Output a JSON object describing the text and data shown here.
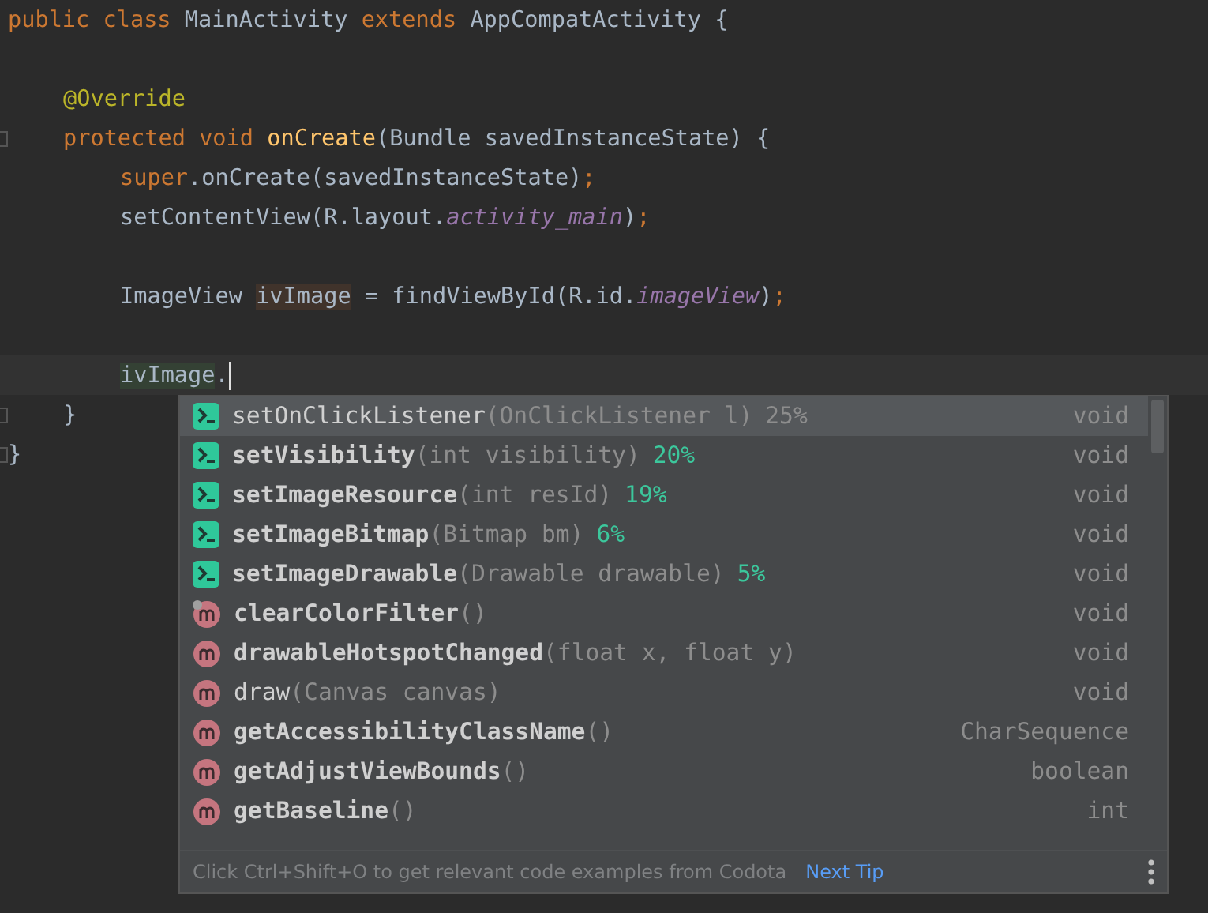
{
  "editor": {
    "lines": [
      {
        "kind": "top",
        "current": false,
        "fold": false,
        "tokens": [
          {
            "text": "public class ",
            "kind": "keyword"
          },
          {
            "text": "MainActivity ",
            "kind": "plain"
          },
          {
            "text": "extends ",
            "kind": "keyword"
          },
          {
            "text": "AppCompatActivity {",
            "kind": "plain"
          }
        ]
      },
      {
        "kind": "top",
        "current": false,
        "fold": false
      },
      {
        "kind": "member",
        "current": false,
        "fold": false,
        "tokens": [
          {
            "text": "@Override",
            "kind": "annotation"
          }
        ]
      },
      {
        "kind": "member",
        "current": false,
        "fold": true,
        "tokens": [
          {
            "text": "protected void ",
            "kind": "keyword"
          },
          {
            "text": "onCreate",
            "kind": "method"
          },
          {
            "text": "(Bundle savedInstanceState) {",
            "kind": "plain"
          }
        ]
      },
      {
        "kind": "body",
        "current": false,
        "fold": false,
        "tokens": [
          {
            "text": "super",
            "kind": "keyword"
          },
          {
            "text": ".onCreate(savedInstanceState)",
            "kind": "plain"
          },
          {
            "text": ";",
            "kind": "keyword"
          }
        ]
      },
      {
        "kind": "body",
        "current": false,
        "fold": false,
        "tokens": [
          {
            "text": "setContentView(R.layout.",
            "kind": "plain"
          },
          {
            "text": "activity_main",
            "kind": "field"
          },
          {
            "text": ")",
            "kind": "plain"
          },
          {
            "text": ";",
            "kind": "keyword"
          }
        ]
      },
      {
        "kind": "body",
        "current": false,
        "fold": false
      },
      {
        "kind": "body",
        "current": false,
        "fold": false,
        "tokens": [
          {
            "text": "ImageView ",
            "kind": "plain"
          },
          {
            "text": "ivImage",
            "kind": "write_usage"
          },
          {
            "text": " = findViewById(R.id.",
            "kind": "plain"
          },
          {
            "text": "imageView",
            "kind": "field"
          },
          {
            "text": ")",
            "kind": "plain"
          },
          {
            "text": ";",
            "kind": "keyword"
          }
        ]
      },
      {
        "kind": "body",
        "current": false,
        "fold": false
      },
      {
        "kind": "body",
        "current": true,
        "fold": false,
        "tokens": [
          {
            "text": "ivImage",
            "kind": "read_usage"
          },
          {
            "text": ".",
            "kind": "plain"
          }
        ]
      },
      {
        "kind": "member",
        "current": false,
        "fold": true,
        "tokens": [
          {
            "text": "}",
            "kind": "plain"
          }
        ]
      },
      {
        "kind": "top",
        "current": false,
        "fold": true,
        "tokens": [
          {
            "text": "}",
            "kind": "plain"
          }
        ]
      }
    ]
  },
  "completion": {
    "items": [
      {
        "kind": "lambda",
        "name": "setOnClickListener",
        "bold": false,
        "params": "(OnClickListener l)",
        "percent": "25%",
        "type": "void",
        "selected": true
      },
      {
        "kind": "lambda",
        "name": "setVisibility",
        "bold": true,
        "params": "(int visibility)",
        "percent": "20%",
        "type": "void",
        "selected": false
      },
      {
        "kind": "lambda",
        "name": "setImageResource",
        "bold": true,
        "params": "(int resId)",
        "percent": "19%",
        "type": "void",
        "selected": false
      },
      {
        "kind": "lambda",
        "name": "setImageBitmap",
        "bold": true,
        "params": "(Bitmap bm)",
        "percent": "6%",
        "type": "void",
        "selected": false
      },
      {
        "kind": "lambda",
        "name": "setImageDrawable",
        "bold": true,
        "params": "(Drawable drawable)",
        "percent": "5%",
        "type": "void",
        "selected": false
      },
      {
        "kind": "marked",
        "name": "clearColorFilter",
        "bold": true,
        "params": "()",
        "type": "void",
        "selected": false
      },
      {
        "kind": "method",
        "name": "drawableHotspotChanged",
        "bold": true,
        "params": "(float x, float y)",
        "type": "void",
        "selected": false
      },
      {
        "kind": "method",
        "name": "draw",
        "bold": false,
        "params": "(Canvas canvas)",
        "type": "void",
        "selected": false
      },
      {
        "kind": "method",
        "name": "getAccessibilityClassName",
        "bold": true,
        "params": "()",
        "type": "CharSequence",
        "selected": false
      },
      {
        "kind": "method",
        "name": "getAdjustViewBounds",
        "bold": true,
        "params": "()",
        "type": "boolean",
        "selected": false
      },
      {
        "kind": "method",
        "name": "getBaseline",
        "bold": true,
        "params": "()",
        "type": "int",
        "selected": false
      }
    ],
    "hint": "Click Ctrl+Shift+O to get relevant code examples from Codota",
    "next_tip": "Next Tip"
  }
}
